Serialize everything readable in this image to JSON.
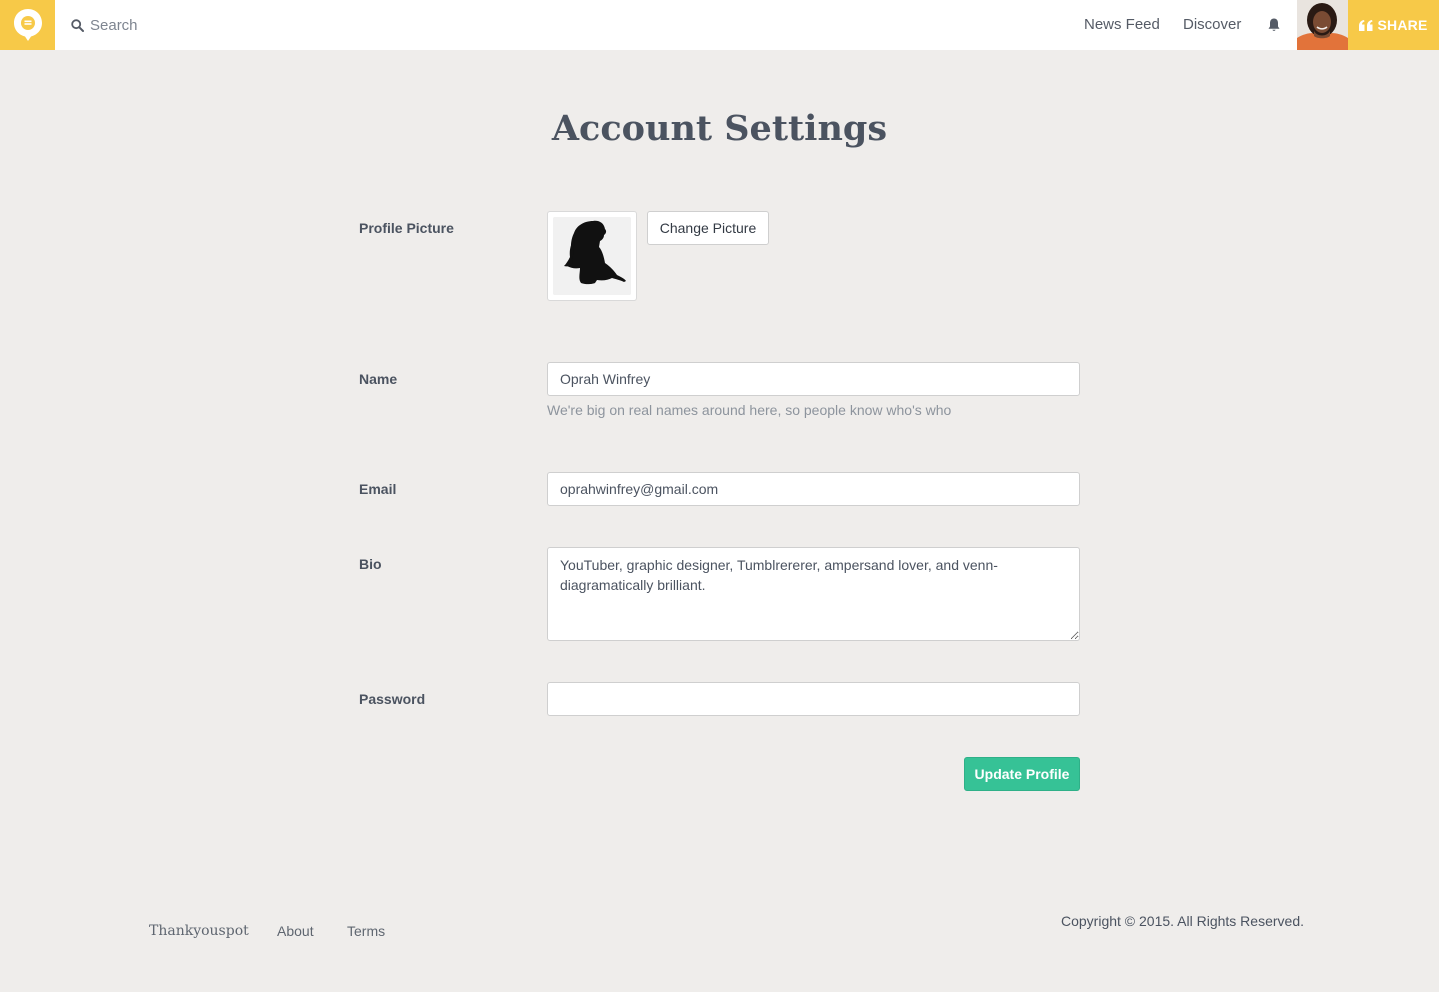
{
  "nav": {
    "search_placeholder": "Search",
    "links": [
      "News Feed",
      "Discover"
    ],
    "notification_icon": "bell-icon",
    "share_label": "SHARE",
    "share_icon": "quote-icon",
    "brand_color": "#f7c948"
  },
  "page": {
    "title": "Account Settings"
  },
  "form": {
    "profile_picture_label": "Profile Picture",
    "change_picture_label": "Change Picture",
    "name_label": "Name",
    "name_value": "Oprah Winfrey",
    "name_help": "We're big on real names around here, so people know who's who",
    "email_label": "Email",
    "email_value": "oprahwinfrey@gmail.com",
    "bio_label": "Bio",
    "bio_value": "YouTuber, graphic designer, Tumblrererer, ampersand lover, and venn-diagramatically brilliant.",
    "password_label": "Password",
    "password_value": "",
    "submit_label": "Update Profile",
    "submit_color": "#36c296"
  },
  "footer": {
    "links": [
      "Thankyouspot",
      "About",
      "Terms"
    ],
    "copyright": "Copyright © 2015. All Rights Reserved."
  }
}
